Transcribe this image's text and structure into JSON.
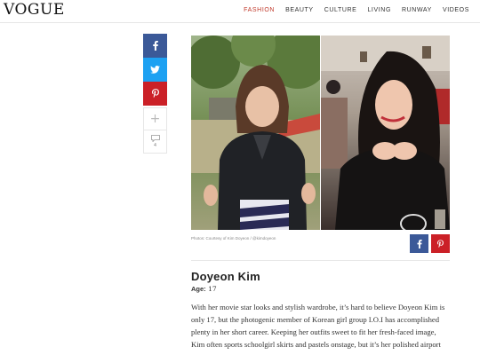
{
  "header": {
    "logo": "VOGUE",
    "nav": [
      {
        "label": "FASHION",
        "active": true
      },
      {
        "label": "BEAUTY",
        "active": false
      },
      {
        "label": "CULTURE",
        "active": false
      },
      {
        "label": "LIVING",
        "active": false
      },
      {
        "label": "RUNWAY",
        "active": false
      },
      {
        "label": "VIDEOS",
        "active": false
      }
    ]
  },
  "share_rail": {
    "comment_count": "4",
    "plus_symbol": "+"
  },
  "article": {
    "photo_credit": "Photos: Courtesy of Kim Doyeon / @kimdoyeon",
    "name": "Doyeon Kim",
    "age_label": "Age:",
    "age_value": "17",
    "body_lines": [
      "With her movie star looks and stylish wardrobe, it’s hard to believe Doyeon Kim is",
      "only 17, but the photogenic member of Korean girl group I.O.I has accomplished",
      "plenty in her short career. Keeping her outfits sweet to fit her fresh-faced image,",
      "Kim often sports schoolgirl skirts and pastels onstage, but it’s her polished airport"
    ]
  },
  "colors": {
    "accent": "#c0392b",
    "facebook": "#3b5998",
    "twitter": "#1da1f2",
    "pinterest": "#cb2027"
  },
  "icons": [
    "facebook-icon",
    "twitter-icon",
    "pinterest-icon",
    "plus-icon",
    "comment-icon"
  ]
}
